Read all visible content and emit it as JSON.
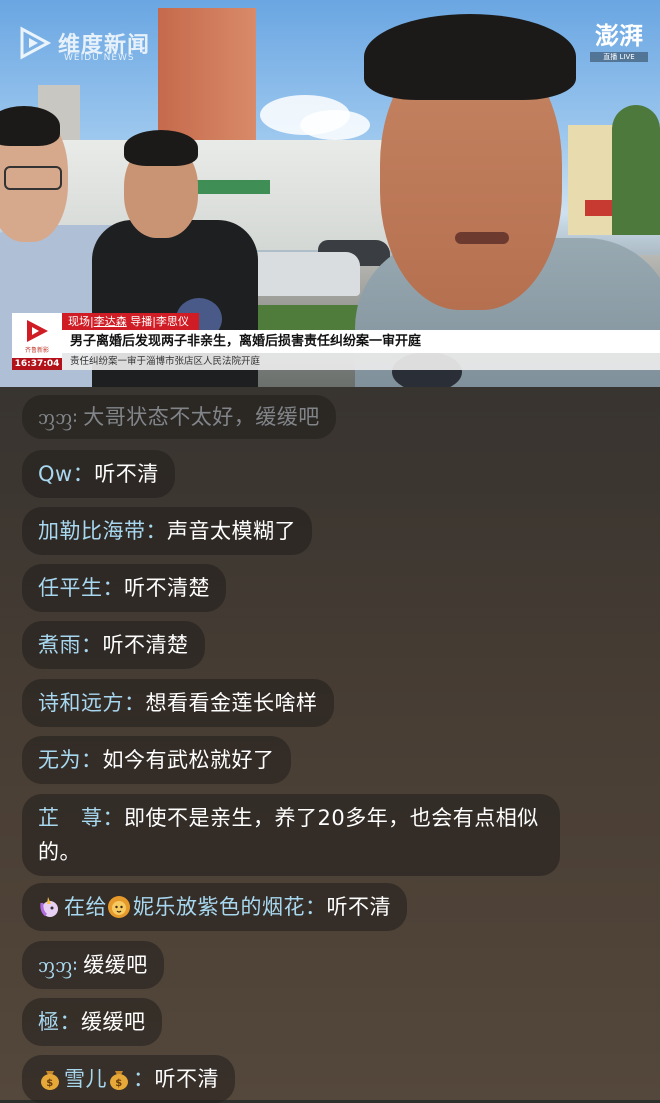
{
  "video": {
    "watermark_left": "维度新闻",
    "watermark_left_sub": "WEIDU NEWS",
    "watermark_right": "澎湃",
    "watermark_right_sub": "直播 LIVE",
    "lower_third": {
      "logo_label": "齐鲁新影",
      "time": "16:37:04",
      "credits_prefix": "现场|",
      "credits_reporter": "李达森",
      "credits_rest": " 导播|李思仪",
      "headline": "男子离婚后发现两子非亲生，离婚后损害责任纠纷案一审开庭",
      "subline": "责任纠纷案一审于淄博市张店区人民法院开庭"
    },
    "colors": {
      "accent_red": "#d01c24",
      "time_red": "#b3121b"
    }
  },
  "comments": [
    {
      "user": "ᦀᦀ",
      "sep": "：",
      "text": "大哥状态不太好，缓缓吧",
      "faded": true
    },
    {
      "user": "Qw",
      "sep": "：",
      "text": "听不清"
    },
    {
      "user": "加勒比海带",
      "sep": "：",
      "text": "声音太模糊了"
    },
    {
      "user": "任平生",
      "sep": "：",
      "text": "听不清楚"
    },
    {
      "user": "煮雨",
      "sep": "：",
      "text": "听不清楚"
    },
    {
      "user": "诗和远方",
      "sep": "：",
      "text": "想看看金莲长啥样"
    },
    {
      "user": "无为",
      "sep": "：",
      "text": "如今有武松就好了"
    },
    {
      "user": "芷　荨",
      "sep": "：",
      "text": "即使不是亲生，养了20多年，也会有点相似的。"
    },
    {
      "user_pre_icon": "unicorn-icon",
      "user_a": "在给",
      "user_mid_icon": "lion-icon",
      "user_b": "妮乐放紫色的烟花",
      "sep": "：",
      "text": "听不清"
    },
    {
      "user": "ᦀᦀ",
      "sep": "：",
      "text": "缓缓吧"
    },
    {
      "user": "極",
      "sep": "：",
      "text": "缓缓吧"
    },
    {
      "user_pre_icon": "money-bag-icon",
      "user": "雪儿",
      "user_post_icon": "money-bag-icon",
      "sep": "：",
      "text": "听不清"
    }
  ],
  "colors": {
    "username": "#a8d8f0",
    "bubble_bg": "rgba(32,30,28,0.55)"
  }
}
